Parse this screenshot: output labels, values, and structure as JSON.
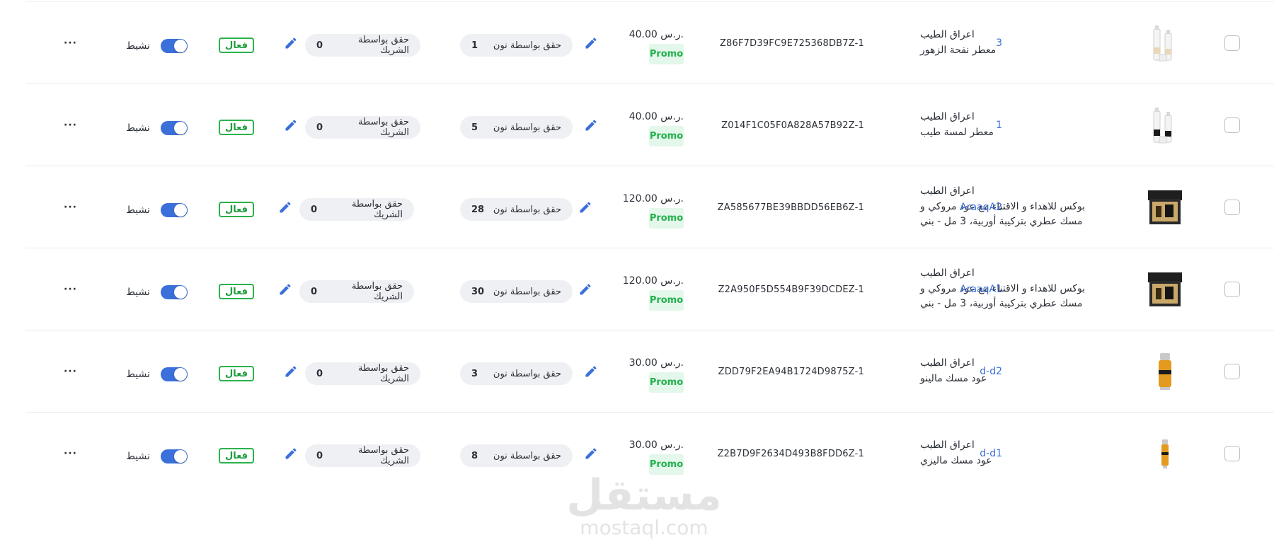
{
  "labels": {
    "currency": "ر.س.",
    "promo": "Promo",
    "fulfilled_by_noon": "حقق بواسطة نون",
    "fulfilled_by_partner": "حقق بواسطة الشريك",
    "status_badge": "فعال",
    "toggle_label": "نشيط",
    "more": "···"
  },
  "colors": {
    "accent": "#3b6fd9",
    "promo_bg": "#e3f7ea",
    "promo_text": "#22b14c",
    "badge_green": "#2bb24c"
  },
  "rows": [
    {
      "brand": "اعراق الطيب",
      "name_lines": [
        "معطر نفحة الزهور"
      ],
      "sku": "3",
      "id": "Z86F7D39FC9E725368DB7Z-1",
      "price": "40.00",
      "noon_qty": "1",
      "partner_qty": "0",
      "active": true,
      "thumb": "spray-bottles"
    },
    {
      "brand": "اعراق الطيب",
      "name_lines": [
        "معطر لمسة طيب"
      ],
      "sku": "1",
      "id": "Z014F1C05F0A828A57B92Z-1",
      "price": "40.00",
      "noon_qty": "5",
      "partner_qty": "0",
      "active": true,
      "thumb": "spray-bottles-dark"
    },
    {
      "brand": "اعراق الطيب",
      "name_lines": [
        "بوكس للاهداء و الاقتناء مع عود مروكي و",
        "مسك عطري بتركيبة أوربية، 3 مل - بني"
      ],
      "sku": "AraaqA2",
      "id": "ZA585677BE39BBDD56EB6Z-1",
      "price": "120.00",
      "noon_qty": "28",
      "partner_qty": "0",
      "active": true,
      "thumb": "gift-box"
    },
    {
      "brand": "اعراق الطيب",
      "name_lines": [
        "بوكس للاهداء و الاقتناء مع عود مروكي و",
        "مسك عطري بتركيبة أوربية، 3 مل - بني"
      ],
      "sku": "AraaqA1",
      "id": "Z2A950F5D554B9F39DCDEZ-1",
      "price": "120.00",
      "noon_qty": "30",
      "partner_qty": "0",
      "active": true,
      "thumb": "gift-box"
    },
    {
      "brand": "اعراق الطيب",
      "name_lines": [
        "عود مسك مالينو"
      ],
      "sku": "d-d2",
      "id": "ZDD79F2EA94B1724D9875Z-1",
      "price": "30.00",
      "noon_qty": "3",
      "partner_qty": "0",
      "active": true,
      "thumb": "oil-bottle"
    },
    {
      "brand": "اعراق الطيب",
      "name_lines": [
        "عود مسك ماليزي"
      ],
      "sku": "d-d1",
      "id": "Z2B7D9F2634D493B8FDD6Z-1",
      "price": "30.00",
      "noon_qty": "8",
      "partner_qty": "0",
      "active": true,
      "thumb": "oil-bottle-small"
    }
  ],
  "watermark": {
    "arabic": "مستقل",
    "latin": "mostaql.com"
  }
}
